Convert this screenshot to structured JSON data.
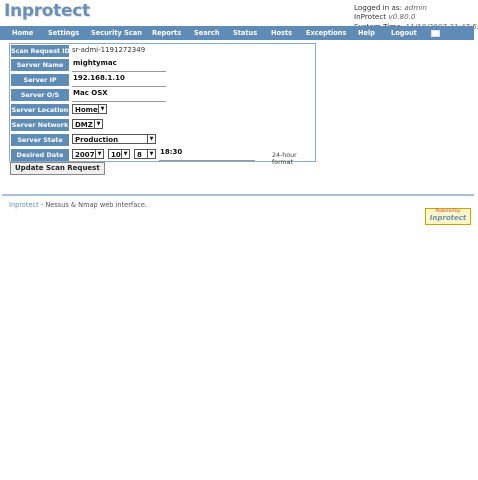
{
  "app": {
    "logo": "Inprotect"
  },
  "login": {
    "logged_label": "Logged in as:",
    "user": "admin",
    "version_label": "InProtect",
    "version": "v0.80.0",
    "time_label": "System Time:",
    "time": "11/18/2007 21:47:55"
  },
  "nav": {
    "items": [
      "Home",
      "Settings",
      "Security Scan",
      "Reports",
      "Search",
      "Status",
      "Hosts",
      "Exceptions",
      "Help",
      "Logout"
    ]
  },
  "form": {
    "scan_request_id": {
      "label": "Scan Request ID",
      "value": "sr-admi-1191272349"
    },
    "server_name": {
      "label": "Server Name",
      "value": "mightymac"
    },
    "server_ip": {
      "label": "Server IP",
      "value": "192.168.1.10"
    },
    "server_os": {
      "label": "Server O/S",
      "value": "Mac OSX"
    },
    "server_location": {
      "label": "Server Location",
      "value": "Home"
    },
    "server_network": {
      "label": "Server Network",
      "value": "DMZ"
    },
    "server_state": {
      "label": "Server State",
      "value": "Production"
    },
    "desired_date": {
      "label": "Desired Date",
      "year": "2007",
      "month": "10",
      "day": "8",
      "time": "18:30",
      "hint": "24-hour format"
    }
  },
  "submit_label": "Update Scan Request",
  "footer": {
    "brand": "Inprotect",
    "text": "- Nessus & Nmap web interface."
  },
  "powered": {
    "small": "Powered by",
    "big": "Inprotect"
  },
  "colors": {
    "nav": "#5f8cb6",
    "logo": "#6a8fb3"
  }
}
